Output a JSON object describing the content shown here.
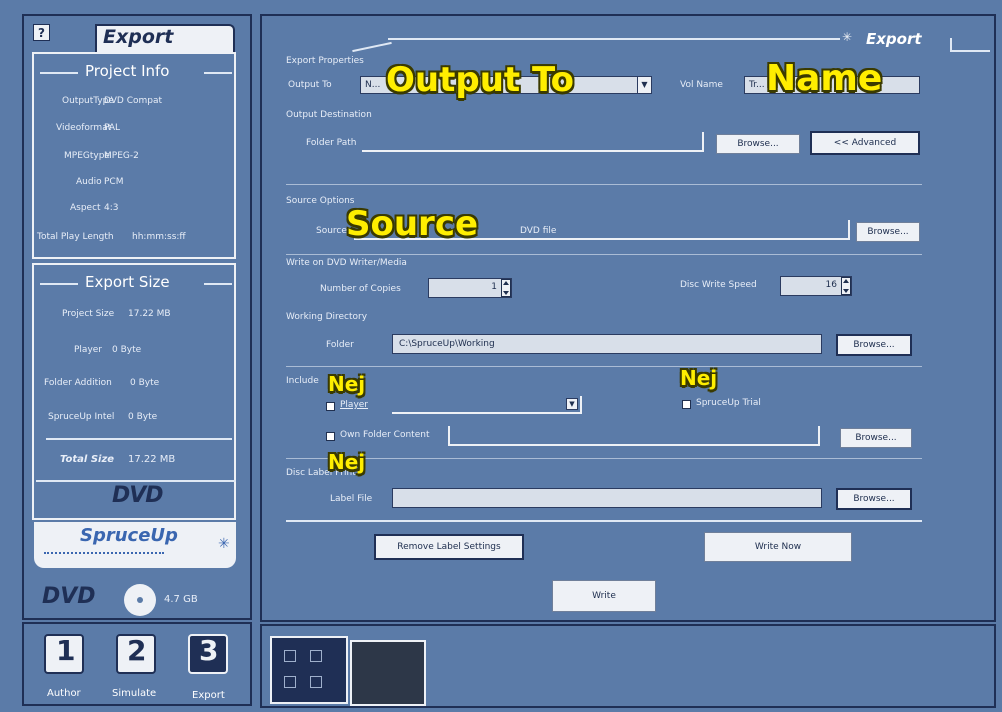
{
  "sidebar": {
    "export_tab": "Export",
    "project_info": {
      "title": "Project Info",
      "rows": [
        {
          "label": "OutputType",
          "value": "DVD Compat"
        },
        {
          "label": "Videoformat",
          "value": "PAL"
        },
        {
          "label": "MPEGtype",
          "value": "MPEG-2"
        },
        {
          "label": "Audio",
          "value": "PCM"
        },
        {
          "label": "Aspect",
          "value": "4:3"
        },
        {
          "label": "Total Play Length",
          "value": "hh:mm:ss:ff"
        }
      ]
    },
    "export_size": {
      "title": "Export Size",
      "rows": [
        {
          "label": "Project Size",
          "value": "17.22 MB"
        },
        {
          "label": "Player",
          "value": "0 Byte"
        },
        {
          "label": "Folder Addition",
          "value": "0 Byte"
        },
        {
          "label": "SpruceUp Intel",
          "value": "0 Byte"
        }
      ],
      "total_label": "Total Size",
      "total_value": "17.22 MB"
    },
    "logo_dvd": "DVD",
    "logo_spruceup": "SpruceUp",
    "disc_label": "DVD",
    "disc_size": "4.7 GB"
  },
  "bottom_nav": [
    {
      "label": "Author",
      "icon": "author-step-icon"
    },
    {
      "label": "Simulate",
      "icon": "simulate-step-icon"
    },
    {
      "label": "Export",
      "icon": "export-step-icon"
    }
  ],
  "main": {
    "tab_title": "Export",
    "export_properties": {
      "section": "Export Properties",
      "output_to_label": "Output To",
      "output_to_value": "N...",
      "name_label": "Vol Name",
      "name_value": "Tr..."
    },
    "output_destination": {
      "section": "Output Destination",
      "folder_label": "Folder Path",
      "browse": "Browse...",
      "advanced": "<< Advanced"
    },
    "source_options": {
      "section": "Source Options",
      "field_label": "Source",
      "hint": "DVD file",
      "browse": "Browse..."
    },
    "write_options": {
      "section": "Write on DVD Writer/Media",
      "copies_label": "Number of Copies",
      "copies_value": "1",
      "speed_label": "Disc Write Speed",
      "speed_value": "16"
    },
    "working_directory": {
      "section": "Working Directory",
      "folder_label": "Folder",
      "folder_value": "C:\\SpruceUp\\Working",
      "browse": "Browse..."
    },
    "include": {
      "section": "Include",
      "player_label": "Player",
      "folder_label": "Own Folder Content",
      "spruceup_trial_label": "SpruceUp Trial",
      "browse": "Browse..."
    },
    "disc_label": {
      "section": "Disc Label Print",
      "field_label": "Label File",
      "browse": "Browse..."
    },
    "buttons": {
      "remove_all": "Remove Label Settings",
      "write_now": "Write Now",
      "write": "Write"
    }
  },
  "overlays": {
    "output_to": "Output To",
    "name": "Name",
    "source": "Source",
    "nej_1": "Nej",
    "nej_2": "Nej",
    "nej_3": "Nej"
  }
}
